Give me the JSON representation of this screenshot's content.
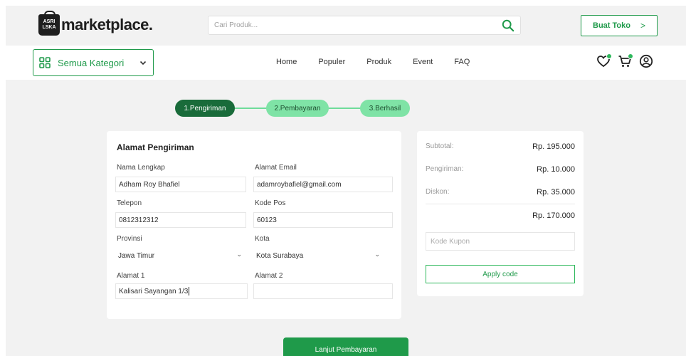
{
  "header": {
    "logo_badge_line1": "ASRI",
    "logo_badge_line2": "LSKA",
    "logo_text": "marketplace.",
    "search_placeholder": "Cari Produk...",
    "buat_toko_label": "Buat Toko",
    "buat_toko_chevron": ">"
  },
  "nav": {
    "kategori_label": "Semua Kategori",
    "links": [
      "Home",
      "Populer",
      "Produk",
      "Event",
      "FAQ"
    ]
  },
  "stepper": {
    "steps": [
      "1.Pengiriman",
      "2.Pembayaran",
      "3.Berhasil"
    ],
    "active_index": 0
  },
  "form": {
    "title": "Alamat Pengiriman",
    "fields": {
      "nama": {
        "label": "Nama Lengkap",
        "value": "Adham Roy Bhafiel"
      },
      "email": {
        "label": "Alamat Email",
        "value": "adamroybafiel@gmail.com"
      },
      "telepon": {
        "label": "Telepon",
        "value": "0812312312"
      },
      "kodepos": {
        "label": "Kode Pos",
        "value": "60123"
      },
      "provinsi": {
        "label": "Provinsi",
        "value": "Jawa Timur"
      },
      "kota": {
        "label": "Kota",
        "value": "Kota Surabaya"
      },
      "alamat1": {
        "label": "Alamat 1",
        "value": "Kalisari Sayangan 1/3"
      },
      "alamat2": {
        "label": "Alamat 2",
        "value": ""
      }
    }
  },
  "summary": {
    "subtotal_label": "Subtotal:",
    "subtotal_value": "Rp. 195.000",
    "pengiriman_label": "Pengiriman:",
    "pengiriman_value": "Rp. 10.000",
    "diskon_label": "Diskon:",
    "diskon_value": "Rp. 35.000",
    "total_value": "Rp. 170.000",
    "kupon_placeholder": "Kode Kupon",
    "apply_label": "Apply code"
  },
  "footer": {
    "lanjut_label": "Lanjut Pembayaran"
  },
  "colors": {
    "brand_green": "#1f9a4a",
    "light_green": "#6fdc9a",
    "dark_green": "#196b3a"
  },
  "icons": [
    "search-icon",
    "grid-icon",
    "chevron-down-icon",
    "heart-icon",
    "cart-icon",
    "user-icon"
  ]
}
